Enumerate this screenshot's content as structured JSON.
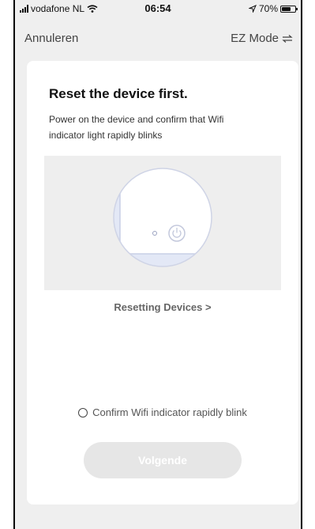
{
  "status_bar": {
    "carrier": "vodafone NL",
    "time": "06:54",
    "battery": "70%",
    "battery_level": 0.7
  },
  "nav": {
    "cancel_label": "Annuleren",
    "mode_label": "EZ Mode"
  },
  "card": {
    "title": "Reset the device first.",
    "description": "Power on the device and confirm that Wifi indicator light rapidly blinks",
    "resetting_link": "Resetting Devices >",
    "confirm_label": "Confirm Wifi indicator rapidly blink",
    "confirm_checked": false,
    "next_button": "Volgende"
  },
  "icons": [
    "signal-icon",
    "wifi-icon",
    "location-arrow-icon",
    "battery-icon",
    "swap-arrows-icon",
    "power-icon",
    "radio-icon"
  ],
  "colors": {
    "background": "#efefef",
    "card": "#ffffff",
    "button_disabled": "#e6e6e6",
    "text_primary": "#111111"
  }
}
